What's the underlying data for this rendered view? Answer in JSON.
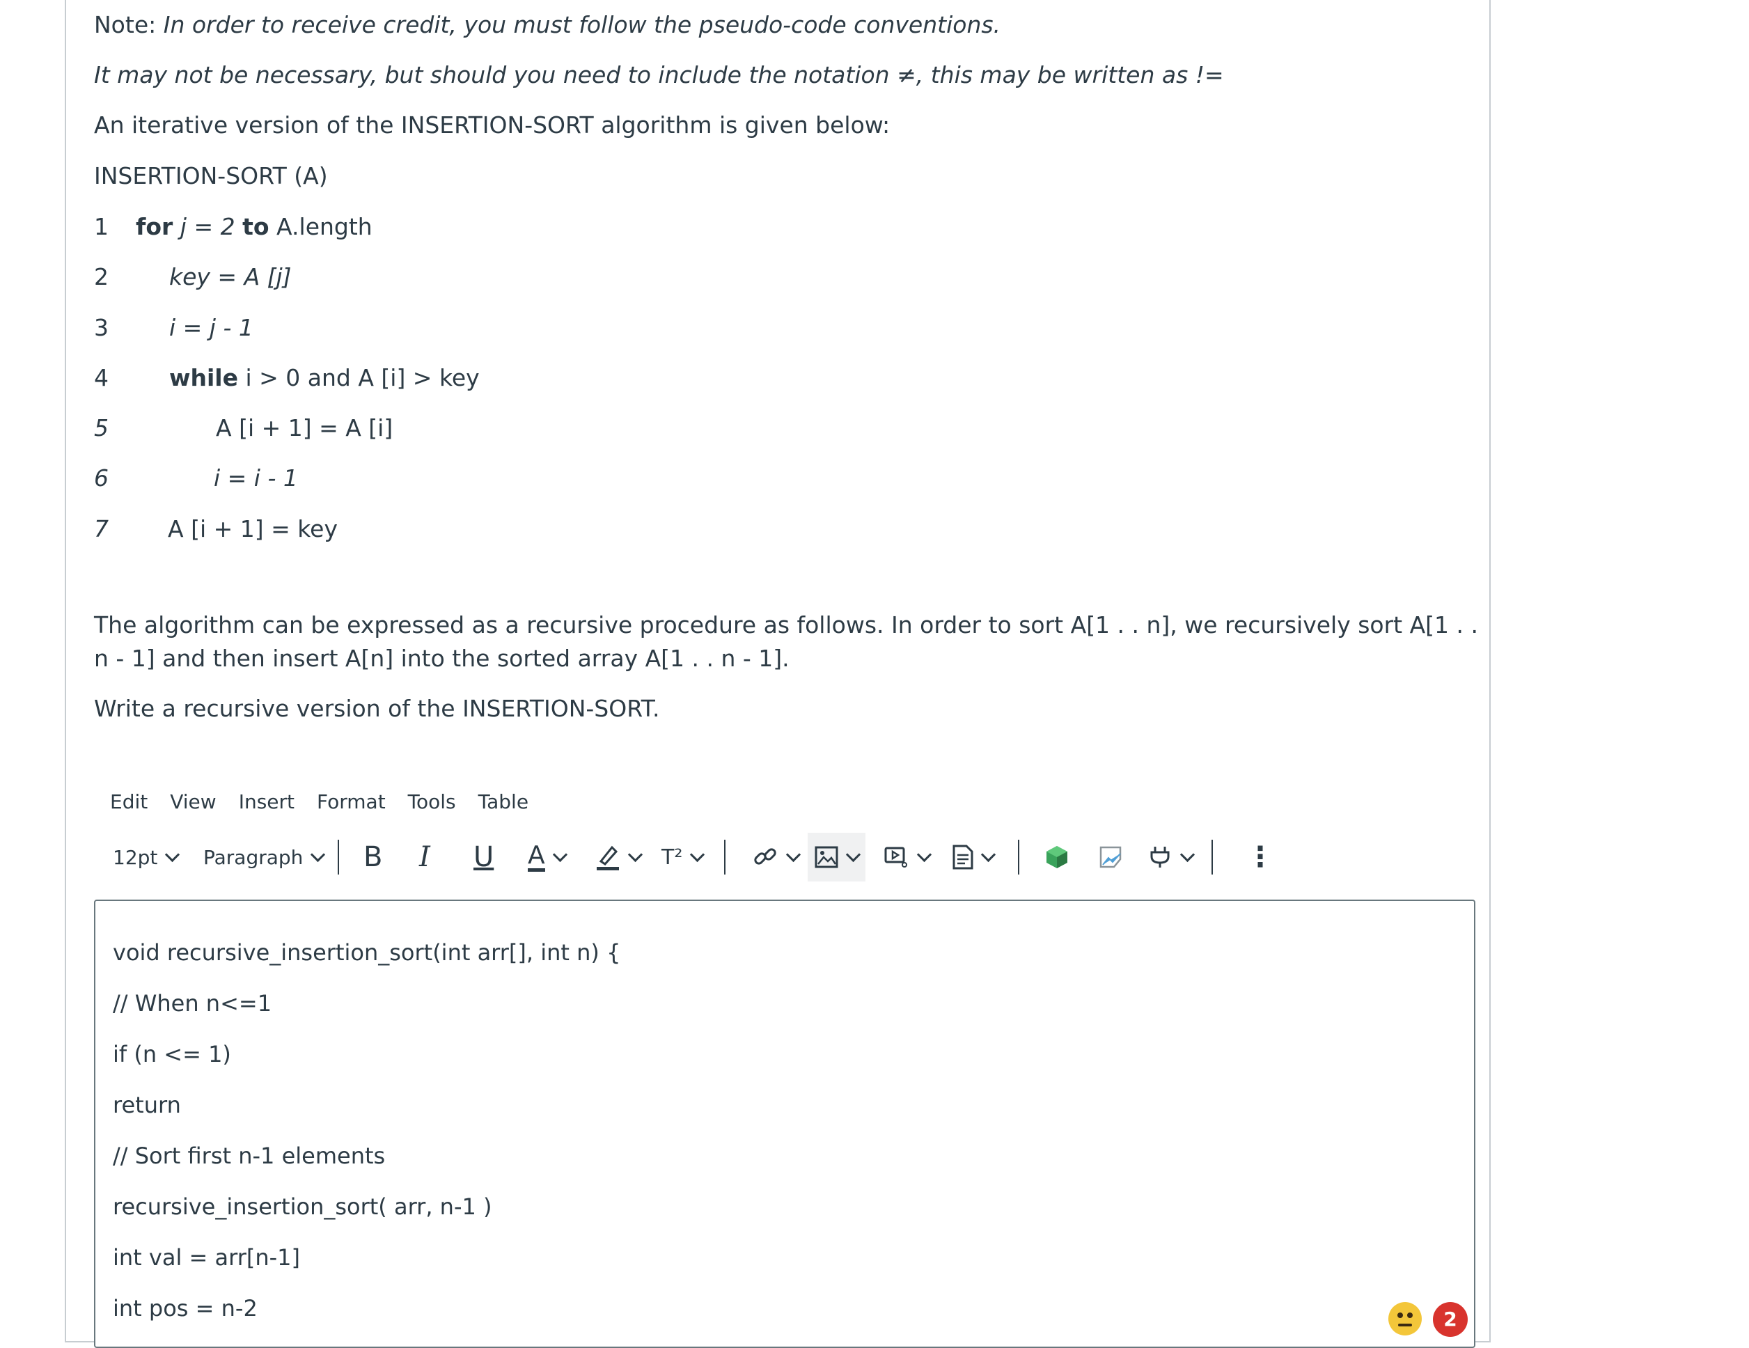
{
  "question": {
    "note_prefix": "Note: ",
    "note_text": "In order to receive credit, you must follow the pseudo-code conventions.",
    "notation_text": "It may not be necessary, but should you need to include the notation ≠, this may be written as !=",
    "intro": "An iterative version of the INSERTION-SORT algorithm is given below:",
    "algo_title": "INSERTION-SORT (A)",
    "lines": [
      {
        "num": "1",
        "kw": "for",
        "text": " j = 2 ",
        "kw2": "to",
        "text2": " A.length"
      },
      {
        "num": "2",
        "text": "key =  A [j]"
      },
      {
        "num": "3",
        "text": "i =  j - 1"
      },
      {
        "num": "4",
        "kw": "while",
        "text": " i > 0 and A [i] > key"
      },
      {
        "num": "5",
        "text": "A [i + 1] = A [i]"
      },
      {
        "num": "6",
        "text": "i =  i - 1"
      },
      {
        "num": "7",
        "text": "A [i + 1] = key"
      }
    ],
    "recursive_desc": "The algorithm can be expressed as a recursive procedure as follows. In order to sort A[1 . . n], we recursively sort A[1 . . n - 1] and then insert A[n] into the sorted array A[1 . . n - 1].",
    "instruction": "Write a recursive version of the INSERTION-SORT."
  },
  "menubar": [
    "Edit",
    "View",
    "Insert",
    "Format",
    "Tools",
    "Table"
  ],
  "toolbar": {
    "font_size": "12pt",
    "block_format": "Paragraph",
    "bold": "B",
    "italic": "I",
    "underline": "U",
    "text_color": "A",
    "superscript": "T²",
    "more": "⋮"
  },
  "editor": {
    "lines": [
      "void recursive_insertion_sort(int arr[], int n) {",
      "// When n<=1",
      "if (n <= 1)",
      "return",
      "// Sort first n-1 elements",
      "recursive_insertion_sort( arr, n-1 )",
      "int val = arr[n-1]",
      "int pos = n-2"
    ]
  },
  "status": {
    "badge_count": "2"
  }
}
